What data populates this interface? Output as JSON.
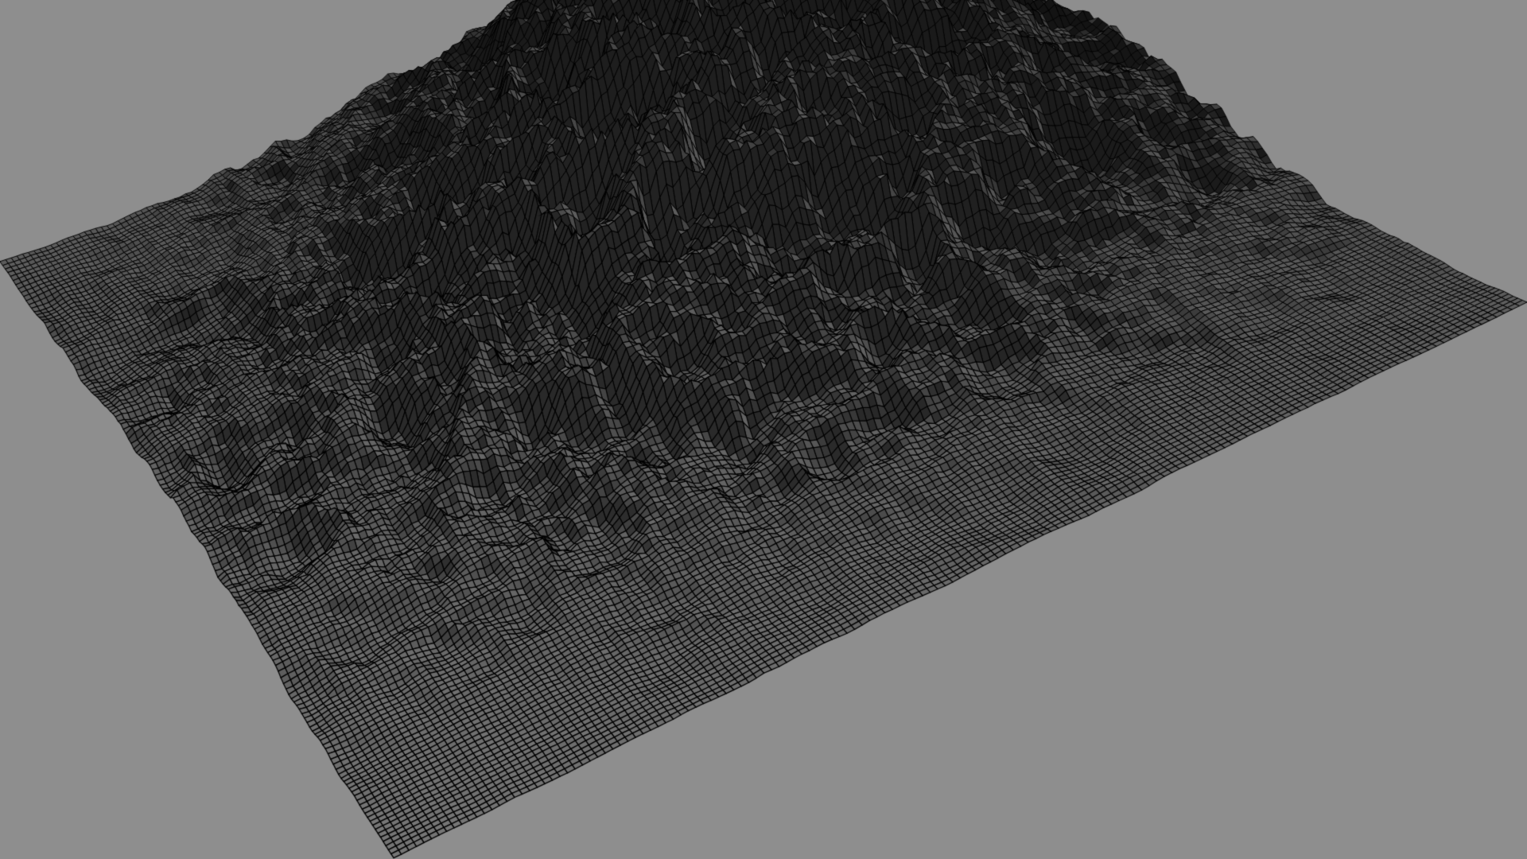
{
  "scene": {
    "render_mode": "wireframe",
    "subject": "heightfield-terrain-mesh",
    "colors": {
      "background": "#8e8e8e",
      "wire": "#000000",
      "shade_light": "#9a9a9a",
      "shade_dark": "#2a2a2a"
    }
  }
}
